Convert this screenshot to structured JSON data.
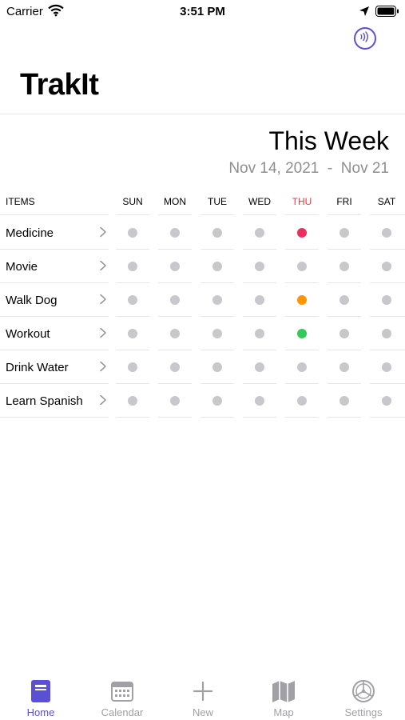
{
  "status": {
    "carrier": "Carrier",
    "time": "3:51 PM"
  },
  "app": {
    "title": "TrakIt"
  },
  "week": {
    "title": "This Week",
    "start": "Nov 14, 2021",
    "separator": "-",
    "end": "Nov 21"
  },
  "table": {
    "items_header": "ITEMS",
    "days": [
      "SUN",
      "MON",
      "TUE",
      "WED",
      "THU",
      "FRI",
      "SAT"
    ],
    "today_index": 4,
    "rows": [
      {
        "label": "Medicine",
        "status": [
          "none",
          "none",
          "none",
          "none",
          "red",
          "none",
          "none"
        ]
      },
      {
        "label": "Movie",
        "status": [
          "none",
          "none",
          "none",
          "none",
          "none",
          "none",
          "none"
        ]
      },
      {
        "label": "Walk Dog",
        "status": [
          "none",
          "none",
          "none",
          "none",
          "orange",
          "none",
          "none"
        ]
      },
      {
        "label": "Workout",
        "status": [
          "none",
          "none",
          "none",
          "none",
          "green",
          "none",
          "none"
        ]
      },
      {
        "label": "Drink Water",
        "status": [
          "none",
          "none",
          "none",
          "none",
          "none",
          "none",
          "none"
        ]
      },
      {
        "label": "Learn Spanish",
        "status": [
          "none",
          "none",
          "none",
          "none",
          "none",
          "none",
          "none"
        ]
      }
    ]
  },
  "tabs": [
    {
      "label": "Home",
      "icon": "home-icon",
      "active": true
    },
    {
      "label": "Calendar",
      "icon": "calendar-icon",
      "active": false
    },
    {
      "label": "New",
      "icon": "plus-icon",
      "active": false
    },
    {
      "label": "Map",
      "icon": "map-icon",
      "active": false
    },
    {
      "label": "Settings",
      "icon": "settings-icon",
      "active": false
    }
  ],
  "colors": {
    "accent": "#5b4fd6",
    "today": "#e5394a",
    "red": "#e9305d",
    "orange": "#ff9500",
    "green": "#34c759",
    "empty": "#c7c7cc"
  }
}
